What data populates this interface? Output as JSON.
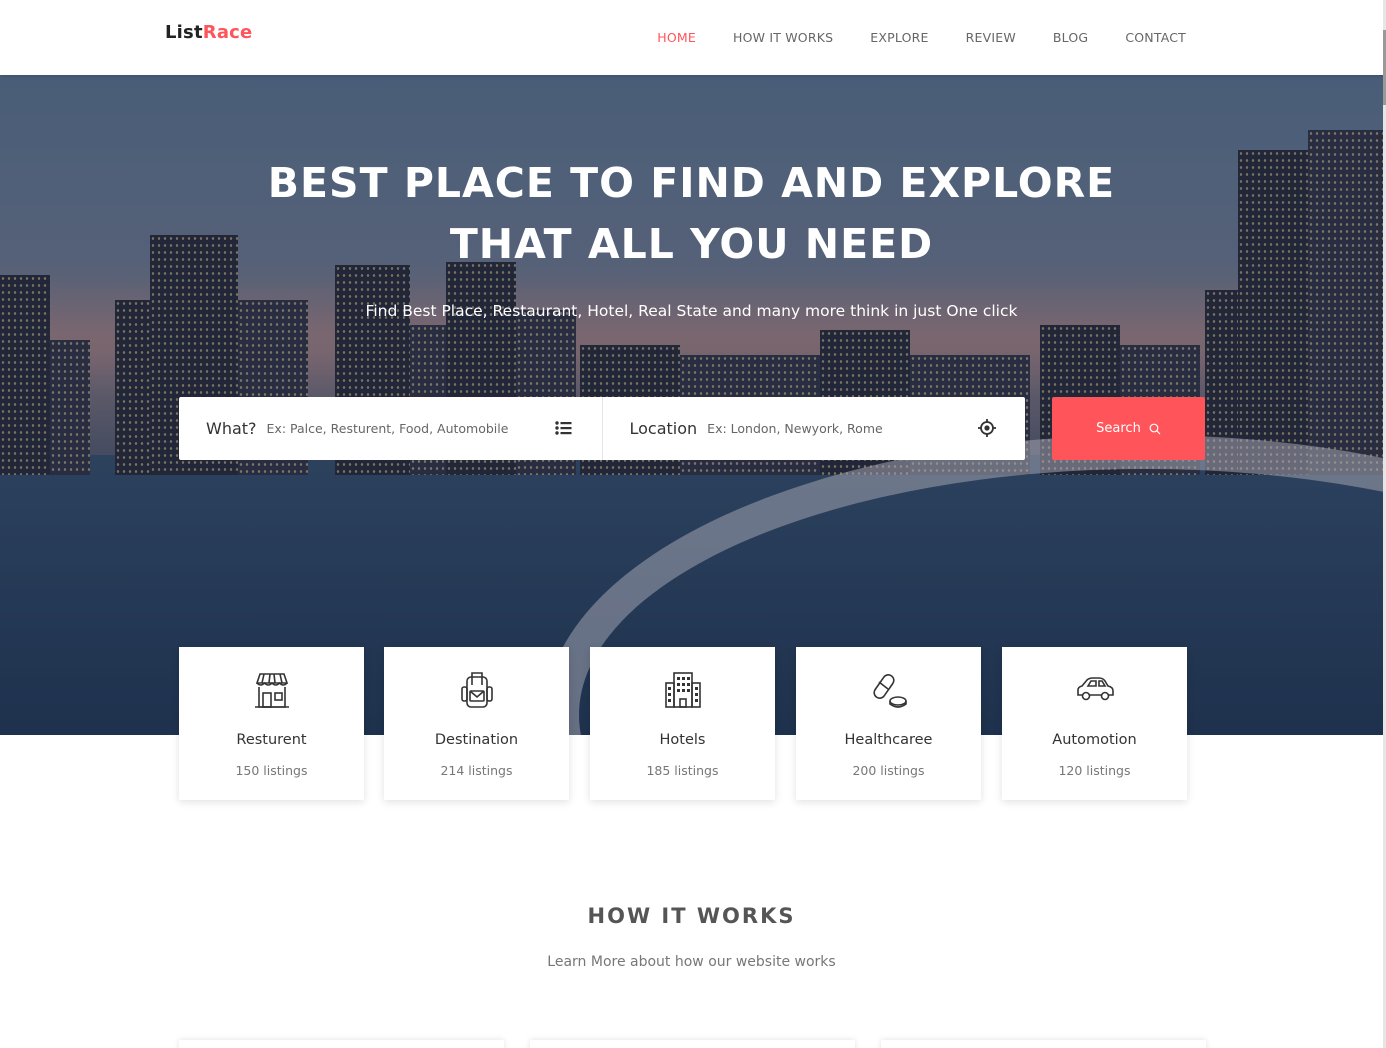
{
  "brand": {
    "part1": "List",
    "part2": "Race",
    "accent_color": "#ff545a"
  },
  "nav": {
    "items": [
      {
        "label": "HOME",
        "active": true
      },
      {
        "label": "HOW IT WORKS",
        "active": false
      },
      {
        "label": "EXPLORE",
        "active": false
      },
      {
        "label": "REVIEW",
        "active": false
      },
      {
        "label": "BLOG",
        "active": false
      },
      {
        "label": "CONTACT",
        "active": false
      }
    ]
  },
  "hero": {
    "title_line1": "BEST PLACE TO FIND AND EXPLORE",
    "title_line2": "THAT ALL YOU NEED",
    "subtitle": "Find Best Place, Restaurant, Hotel, Real State and many more think in just One click"
  },
  "search": {
    "what_label": "What?",
    "what_placeholder": "Ex: Palce, Resturent, Food, Automobile",
    "what_icon": "list-icon",
    "location_label": "Location",
    "location_placeholder": "Ex: London, Newyork, Rome",
    "location_icon": "locate-target-icon",
    "button_label": "Search",
    "button_icon": "search-icon"
  },
  "categories": [
    {
      "name": "Resturent",
      "count": "150 listings",
      "icon": "store-icon"
    },
    {
      "name": "Destination",
      "count": "214 listings",
      "icon": "backpack-icon"
    },
    {
      "name": "Hotels",
      "count": "185 listings",
      "icon": "building-icon"
    },
    {
      "name": "Healthcaree",
      "count": "200 listings",
      "icon": "pill-icon"
    },
    {
      "name": "Automotion",
      "count": "120 listings",
      "icon": "car-icon"
    }
  ],
  "how_it_works": {
    "title": "HOW IT WORKS",
    "subtitle": "Learn More about how our website works"
  }
}
